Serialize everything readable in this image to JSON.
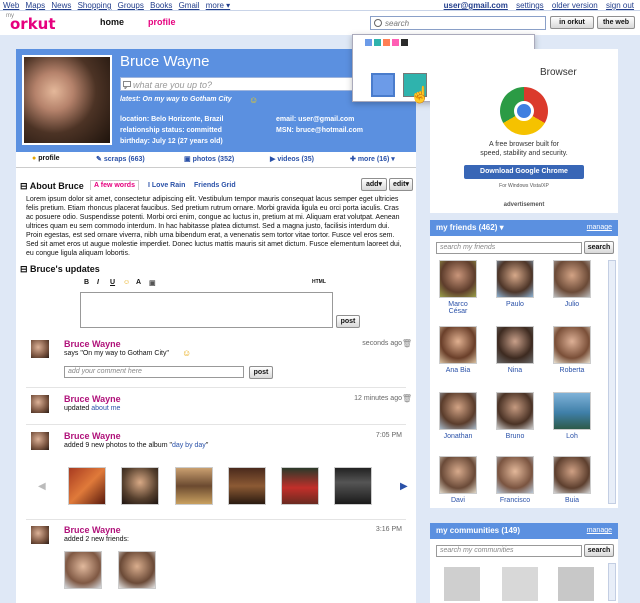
{
  "top_links": [
    "Web",
    "Maps",
    "News",
    "Shopping",
    "Groups",
    "Books",
    "Gmail",
    "more ▾"
  ],
  "user_links": {
    "email": "user@gmail.com",
    "settings": "settings",
    "older_version": "older version",
    "sign_out": "sign out"
  },
  "logo": {
    "my": "my",
    "brand": "orkut"
  },
  "nav": {
    "home": "home",
    "profile": "profile"
  },
  "search": {
    "placeholder": "search",
    "in_orkut": "in orkut",
    "the_web": "the web"
  },
  "profile": {
    "name": "Bruce Wayne",
    "status_placeholder": "what are you up to?",
    "latest": "latest: On my way to Gotham City",
    "location": "location: Belo Horizonte, Brazil",
    "relationship": "relationship status: committed",
    "birthday": "birthday: July 12 (27 years old)",
    "email": "email:  user@gmail.com",
    "msn": "MSN: bruce@hotmail.com"
  },
  "tabs": [
    "profile",
    "scraps (663)",
    "photos (352)",
    "videos (35)",
    "more (16) ▾"
  ],
  "about": {
    "title": "About Bruce",
    "subtabs": [
      "A few words",
      "I Love Rain",
      "Friends Grid"
    ],
    "add": "add▾",
    "edit": "edit▾",
    "text": "Lorem ipsum dolor sit amet, consectetur adipiscing elit. Vestibulum tempor mauris consequat lacus semper eget ultricies felis pretium. Etiam rhoncus placerat faucibus. Sed pretium rutrum ornare. Morbi gravida ligula eu orci porta iaculis. Cras ac posuere odio. Suspendisse potenti. Morbi orci enim, congue ac luctus in, pretium at mi. Aliquam erat volutpat. Aenean ultrices quam eu sem commodo interdum. In hac habitasse platea dictumst. Sed a magna justo, facilisis interdum dui. Proin egestas, est sed ornare viverra, nibh urna bibendum erat, a venenatis sem tortor vitae tortor. Fusce vel eros sem. Sed sit amet eros ut augue molestie imperdiet. Donec luctus mattis mauris sit amet dictum. Fusce elementum laoreet dui, eu congue ligula aliquam lobortis."
  },
  "updates": {
    "title": "Bruce's updates",
    "toolbar": [
      "B",
      "I",
      "U",
      "A",
      "HTML"
    ],
    "post": "post",
    "items": [
      {
        "name": "Bruce Wayne",
        "text": "says \"On my way to Gotham City\"",
        "time": "seconds ago",
        "comment_placeholder": "add your comment here"
      },
      {
        "name": "Bruce Wayne",
        "text": "updated",
        "link": "about me",
        "time": "12 minutes ago"
      },
      {
        "name": "Bruce Wayne",
        "text": "added 9 new photos to the album \"",
        "link": "day by day",
        "text_end": "\"",
        "time": "7:05 PM"
      },
      {
        "name": "Bruce Wayne",
        "text": "added 2 new friends:",
        "time": "3:16 PM"
      }
    ]
  },
  "ad": {
    "title": "Browser",
    "line1": "A free browser built for",
    "line2": "speed, stability and security.",
    "button": "Download Google Chrome",
    "os": "For Windows Vista/XP",
    "label": "advertisement"
  },
  "friends": {
    "title": "my friends (462)",
    "manage": "manage",
    "search_placeholder": "search my friends",
    "search_button": "search",
    "names": [
      "Marco César",
      "Paulo",
      "Julio",
      "Ana Bia",
      "Nina",
      "Roberta",
      "Jonathan",
      "Bruno",
      "Loh",
      "Davi",
      "Francisco",
      "Buia"
    ]
  },
  "communities": {
    "title": "my communities (149)",
    "manage": "manage",
    "search_placeholder": "search my communities",
    "search_button": "search"
  },
  "colors": {
    "accent": "#5b90e0",
    "pink": "#e6007e",
    "link": "#2a51a8",
    "swatches": [
      "#6c9be8",
      "#2fb3ad",
      "#ff7f55",
      "#ff5fb5",
      "#2b2b2b"
    ]
  }
}
